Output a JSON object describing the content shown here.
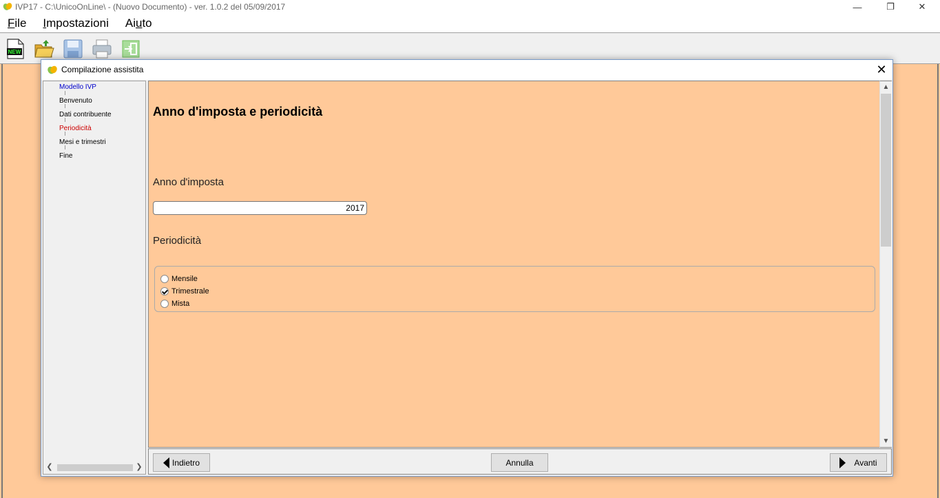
{
  "window": {
    "title": "IVP17 - C:\\UnicoOnLine\\ - (Nuovo Documento)  -  ver. 1.0.2 del 05/09/2017",
    "minimize_glyph": "—",
    "maximize_glyph": "❐",
    "close_glyph": "✕"
  },
  "menu": {
    "items": [
      {
        "first": "F",
        "rest": "ile"
      },
      {
        "first": "I",
        "rest": "mpostazioni"
      },
      {
        "pre": "Ai",
        "first": "u",
        "rest": "to"
      }
    ]
  },
  "toolbar": {
    "buttons": [
      "new-document",
      "open-folder",
      "save",
      "print",
      "exit"
    ],
    "new_label": "NEW"
  },
  "dialog": {
    "title": "Compilazione assistita",
    "close_glyph": "✕",
    "tree": {
      "root": "Modello IVP",
      "items": [
        "Benvenuto",
        "Dati contribuente",
        "Periodicità",
        "Mesi e trimestri",
        "Fine"
      ],
      "active_index": 2
    },
    "heading": "Anno d'imposta e periodicità",
    "year_label": "Anno d'imposta",
    "year_value": "2017",
    "period_label": "Periodicità",
    "options": [
      "Mensile",
      "Trimestrale",
      "Mista"
    ],
    "selected_option": "Trimestrale",
    "buttons": {
      "back": "Indietro",
      "cancel": "Annulla",
      "next": "Avanti"
    }
  },
  "colors": {
    "content_bg": "#ffc999",
    "tree_root": "#0000cc",
    "tree_active": "#cc0000"
  }
}
